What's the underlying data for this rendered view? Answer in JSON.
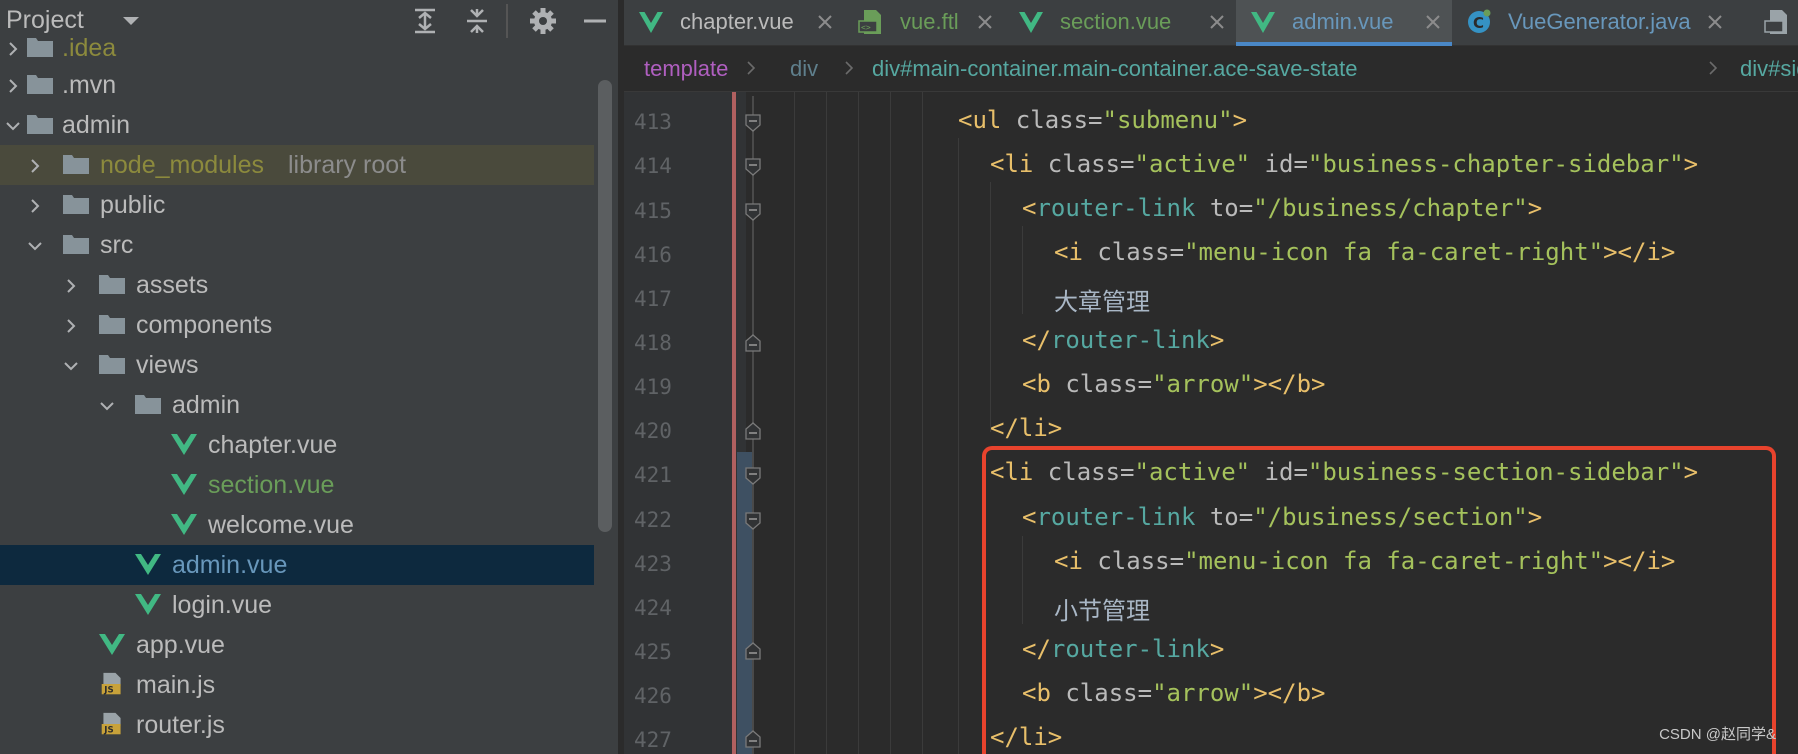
{
  "project_panel": {
    "title": "Project",
    "tree": [
      {
        "label": ".idea",
        "kind": "folder",
        "state": "ignored"
      },
      {
        "label": ".mvn",
        "kind": "folder",
        "state": "normal"
      },
      {
        "label": "admin",
        "kind": "folder",
        "state": "normal"
      },
      {
        "label": "node_modules",
        "note": "library root",
        "kind": "folder",
        "state": "ignored"
      },
      {
        "label": "public",
        "kind": "folder",
        "state": "normal"
      },
      {
        "label": "src",
        "kind": "folder",
        "state": "normal"
      },
      {
        "label": "assets",
        "kind": "folder",
        "state": "normal"
      },
      {
        "label": "components",
        "kind": "folder",
        "state": "normal"
      },
      {
        "label": "views",
        "kind": "folder",
        "state": "normal"
      },
      {
        "label": "admin",
        "kind": "folder",
        "state": "normal"
      },
      {
        "label": "chapter.vue",
        "kind": "vue",
        "state": "normal"
      },
      {
        "label": "section.vue",
        "kind": "vue",
        "state": "added"
      },
      {
        "label": "welcome.vue",
        "kind": "vue",
        "state": "normal"
      },
      {
        "label": "admin.vue",
        "kind": "vue",
        "state": "modified"
      },
      {
        "label": "login.vue",
        "kind": "vue",
        "state": "normal"
      },
      {
        "label": "app.vue",
        "kind": "vue",
        "state": "normal"
      },
      {
        "label": "main.js",
        "kind": "js",
        "state": "normal"
      },
      {
        "label": "router.js",
        "kind": "js",
        "state": "normal"
      }
    ]
  },
  "tabs": [
    {
      "label": "chapter.vue",
      "icon": "vue-icon",
      "color": "#bbbbbb"
    },
    {
      "label": "vue.ftl",
      "icon": "ftl-icon",
      "color": "#6a9d59"
    },
    {
      "label": "section.vue",
      "icon": "vue-icon",
      "color": "#6a9d59"
    },
    {
      "label": "admin.vue",
      "icon": "vue-icon",
      "color": "#6897bb",
      "active": true
    },
    {
      "label": "VueGenerator.java",
      "icon": "java-class-icon",
      "color": "#6897bb"
    }
  ],
  "breadcrumb": [
    "template",
    "div",
    "div#main-container.main-container.ace-save-state",
    "div#sidebar.sidebar.respon"
  ],
  "line_numbers": [
    "413",
    "414",
    "415",
    "416",
    "417",
    "418",
    "419",
    "420",
    "421",
    "422",
    "423",
    "424",
    "425",
    "426",
    "427"
  ],
  "code": {
    "l413": {
      "tag_open": "<ul",
      "attr1": " class=",
      "val1": "\"submenu\"",
      "tag_close": ">"
    },
    "l414": {
      "tag_open": "<li",
      "attr1": " class=",
      "val1": "\"active\"",
      "attr2": " id=",
      "val2": "\"business-chapter-sidebar\"",
      "tag_close": ">"
    },
    "l415": {
      "tag_open": "<",
      "comp": "router-link",
      "attr1": " to=",
      "val1": "\"/business/chapter\"",
      "tag_close": ">"
    },
    "l416": {
      "tag_open": "<i",
      "attr1": " class=",
      "val1": "\"menu-icon fa fa-caret-right\"",
      "tag_close": "></i>"
    },
    "l417": {
      "text": "大章管理"
    },
    "l418": {
      "tag_open": "</",
      "comp": "router-link",
      "tag_close": ">"
    },
    "l419": {
      "tag_open": "<b",
      "attr1": " class=",
      "val1": "\"arrow\"",
      "tag_close": "></b>"
    },
    "l420": {
      "tag_open": "</li>"
    },
    "l421": {
      "tag_open": "<li",
      "attr1": " class=",
      "val1": "\"active\"",
      "attr2": " id=",
      "val2": "\"business-section-sidebar\"",
      "tag_close": ">"
    },
    "l422": {
      "tag_open": "<",
      "comp": "router-link",
      "attr1": " to=",
      "val1": "\"/business/section\"",
      "tag_close": ">"
    },
    "l423": {
      "tag_open": "<i",
      "attr1": " class=",
      "val1": "\"menu-icon fa fa-caret-right\"",
      "tag_close": "></i>"
    },
    "l424": {
      "text": "小节管理"
    },
    "l425": {
      "tag_open": "</",
      "comp": "router-link",
      "tag_close": ">"
    },
    "l426": {
      "tag_open": "<b",
      "attr1": " class=",
      "val1": "\"arrow\"",
      "tag_close": "></b>"
    },
    "l427": {
      "tag_open": "</li>"
    }
  },
  "watermark": "CSDN @赵同学&",
  "colors": {
    "panel_bg": "#3c3f41",
    "editor_bg": "#2b2b2b",
    "accent": "#4a88c7",
    "highlight_box": "#e8432d"
  }
}
